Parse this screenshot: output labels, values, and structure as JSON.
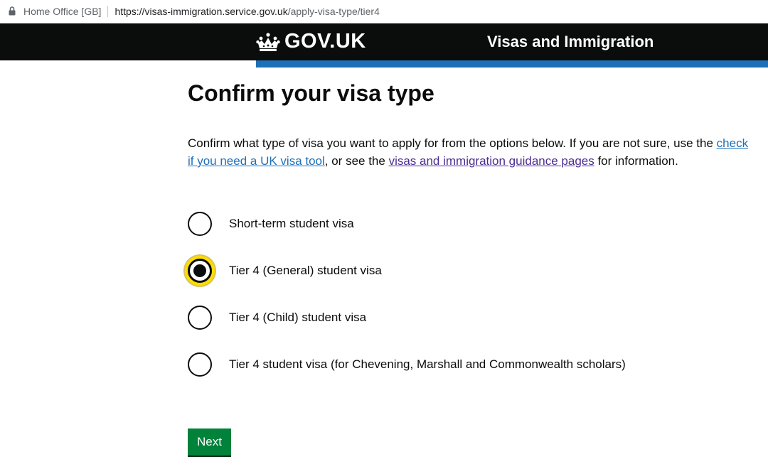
{
  "browser": {
    "site_owner": "Home Office [GB]",
    "url_host": "https://visas-immigration.service.gov.uk",
    "url_path": "/apply-visa-type/tier4"
  },
  "header": {
    "logo_text": "GOV.UK",
    "service_name": "Visas and Immigration",
    "background_color": "#0b0c0c",
    "stripe_color": "#1d70b8"
  },
  "main": {
    "title": "Confirm your visa type",
    "lead": {
      "text_before": "Confirm what type of visa you want to apply for from the options below. If you are not sure, use the ",
      "link1": "check if you need a UK visa tool",
      "text_middle": ", or see the ",
      "link2": "visas and immigration guidance pages",
      "text_after": " for information."
    },
    "options": [
      {
        "label": "Short-term student visa",
        "checked": false
      },
      {
        "label": "Tier 4 (General) student visa",
        "checked": true
      },
      {
        "label": "Tier 4 (Child) student visa",
        "checked": false
      },
      {
        "label": "Tier 4 student visa (for Chevening, Marshall and Commonwealth scholars)",
        "checked": false
      }
    ],
    "next_label": "Next",
    "next_color": "#00823b",
    "focus_color": "#ffdd00"
  }
}
